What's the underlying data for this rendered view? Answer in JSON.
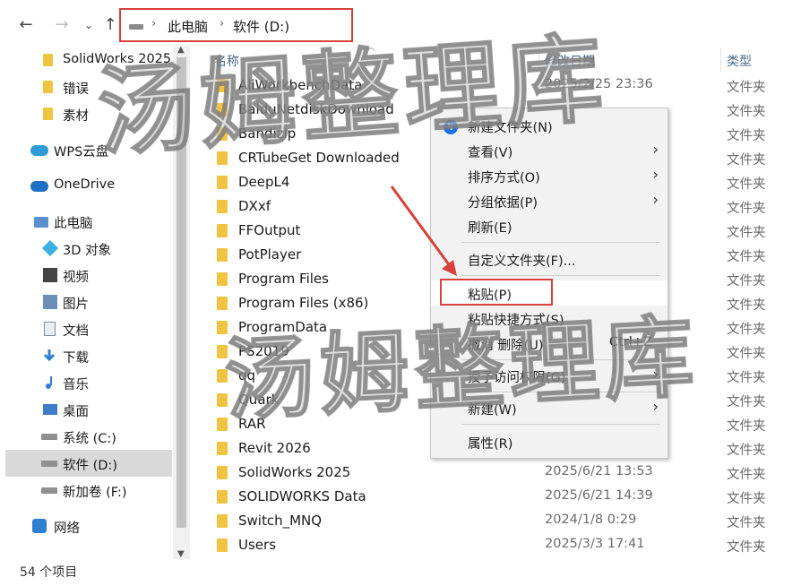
{
  "address": {
    "pc": "此电脑",
    "drive": "软件 (D:)"
  },
  "nav": {
    "back": "←",
    "forward": "→",
    "recent": "⌄",
    "up": "↑",
    "sep": "›"
  },
  "sidebar": {
    "items": [
      {
        "label": "SolidWorks 2025",
        "icon": "folder-icon"
      },
      {
        "label": "错误",
        "icon": "folder-icon"
      },
      {
        "label": "素材",
        "icon": "folder-icon"
      },
      {
        "label": "WPS云盘",
        "icon": "cloud-icon"
      },
      {
        "label": "OneDrive",
        "icon": "cloud-icon"
      },
      {
        "label": "此电脑",
        "icon": "pc-icon"
      },
      {
        "label": "3D 对象",
        "icon": "3d-objects-icon"
      },
      {
        "label": "视频",
        "icon": "video-icon"
      },
      {
        "label": "图片",
        "icon": "pictures-icon"
      },
      {
        "label": "文档",
        "icon": "documents-icon"
      },
      {
        "label": "下载",
        "icon": "download-icon"
      },
      {
        "label": "音乐",
        "icon": "music-icon"
      },
      {
        "label": "桌面",
        "icon": "desktop-icon"
      },
      {
        "label": "系统 (C:)",
        "icon": "drive-icon"
      },
      {
        "label": "软件 (D:)",
        "icon": "drive-icon"
      },
      {
        "label": "新加卷 (F:)",
        "icon": "drive-icon"
      },
      {
        "label": "网络",
        "icon": "network-icon"
      }
    ]
  },
  "columns": {
    "name": "名称",
    "date": "修改日期",
    "type": "类型"
  },
  "files": [
    {
      "name": "AliWorkbenchData",
      "date": "2025/2/25 23:36",
      "type": "文件夹"
    },
    {
      "name": "BaiduNetdiskDownload",
      "date": "",
      "type": "文件夹"
    },
    {
      "name": "Bandizip",
      "date": "",
      "type": "文件夹"
    },
    {
      "name": "CRTubeGet Downloaded",
      "date": "",
      "type": "文件夹"
    },
    {
      "name": "DeepL4",
      "date": "",
      "type": "文件夹"
    },
    {
      "name": "DXxf",
      "date": "",
      "type": "文件夹"
    },
    {
      "name": "FFOutput",
      "date": "",
      "type": "文件夹"
    },
    {
      "name": "PotPlayer",
      "date": "",
      "type": "文件夹"
    },
    {
      "name": "Program Files",
      "date": "",
      "type": "文件夹"
    },
    {
      "name": "Program Files (x86)",
      "date": "",
      "type": "文件夹"
    },
    {
      "name": "ProgramData",
      "date": "",
      "type": "文件夹"
    },
    {
      "name": "PS2019",
      "date": "",
      "type": "文件夹"
    },
    {
      "name": "qq",
      "date": "",
      "type": "文件夹"
    },
    {
      "name": "Quark",
      "date": "",
      "type": "文件夹"
    },
    {
      "name": "RAR",
      "date": "",
      "type": "文件夹"
    },
    {
      "name": "Revit 2026",
      "date": "",
      "type": "文件夹"
    },
    {
      "name": "SolidWorks 2025",
      "date": "2025/6/21 13:53",
      "type": "文件夹"
    },
    {
      "name": "SOLIDWORKS Data",
      "date": "2025/6/21 14:39",
      "type": "文件夹"
    },
    {
      "name": "Switch_MNQ",
      "date": "2024/1/8 0:29",
      "type": "文件夹"
    },
    {
      "name": "Users",
      "date": "2025/3/3 17:41",
      "type": "文件夹"
    }
  ],
  "status": {
    "count": "54 个项目"
  },
  "context_menu": {
    "items": [
      {
        "label": "新建文件夹(N)",
        "icon": "new-folder-icon",
        "submenu": false,
        "shortcut": ""
      },
      {
        "label": "查看(V)",
        "submenu": true,
        "shortcut": ""
      },
      {
        "label": "排序方式(O)",
        "submenu": true,
        "shortcut": ""
      },
      {
        "label": "分组依据(P)",
        "submenu": true,
        "shortcut": ""
      },
      {
        "label": "刷新(E)",
        "submenu": false,
        "shortcut": ""
      },
      {
        "label": "自定义文件夹(F)...",
        "submenu": false,
        "shortcut": ""
      },
      {
        "label": "粘贴(P)",
        "submenu": false,
        "shortcut": ""
      },
      {
        "label": "粘贴快捷方式(S)",
        "submenu": false,
        "shortcut": ""
      },
      {
        "label": "撤消 删除(U)",
        "submenu": false,
        "shortcut": "Ctrl+Z"
      },
      {
        "label": "授予访问权限(G)",
        "submenu": true,
        "shortcut": ""
      },
      {
        "label": "新建(W)",
        "submenu": true,
        "shortcut": ""
      },
      {
        "label": "属性(R)",
        "submenu": false,
        "shortcut": ""
      }
    ]
  },
  "watermark": "汤姆整理库",
  "colors": {
    "highlight_red": "#d9403a",
    "folder": "#f1c342",
    "accent": "#1a73e8"
  }
}
